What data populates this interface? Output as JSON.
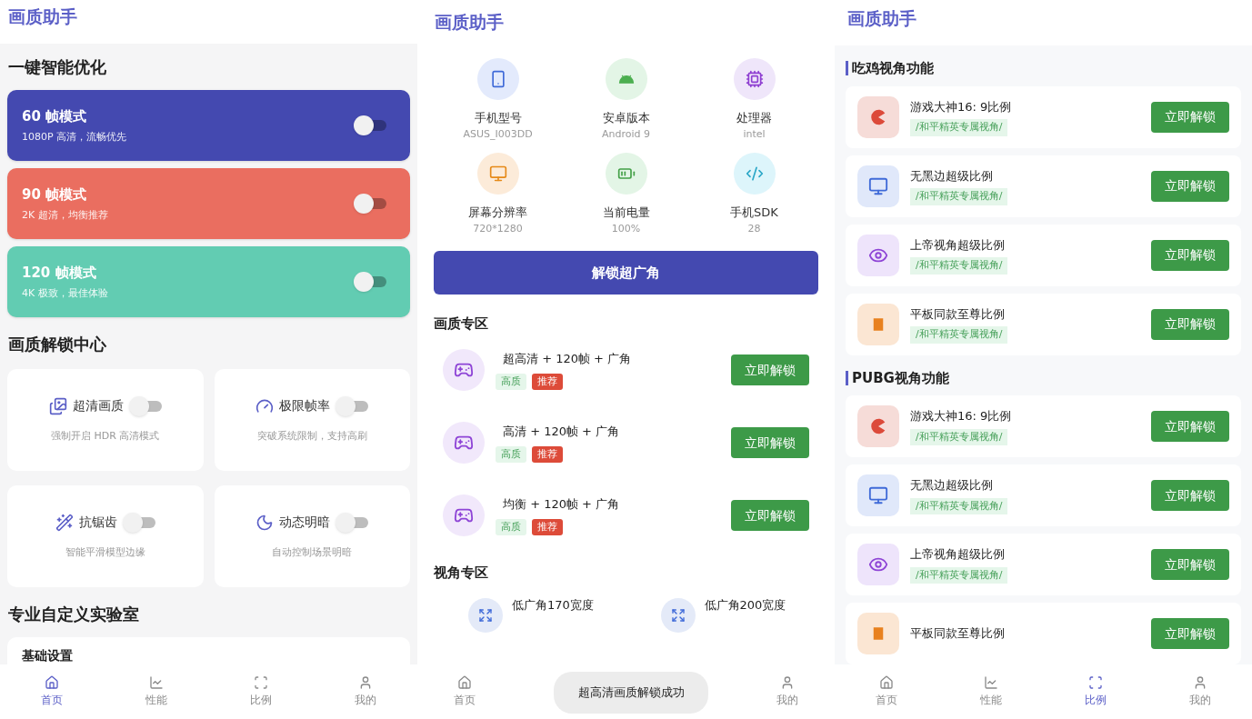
{
  "home_screen": {
    "title": "画质助手",
    "smart_heading": "一键智能优化",
    "modes": [
      {
        "name": "60 帧模式",
        "desc": "1080P 高清，流畅优先",
        "color": "#4449b0",
        "on": false
      },
      {
        "name": "90 帧模式",
        "desc": "2K 超清，均衡推荐",
        "color": "#ea6e60",
        "on": false
      },
      {
        "name": "120 帧模式",
        "desc": "4K 极致，最佳体验",
        "color": "#62ccb2",
        "on": false
      }
    ],
    "unlock_heading": "画质解锁中心",
    "features": [
      {
        "label": "超清画质",
        "desc": "强制开启 HDR 高清模式",
        "on": false
      },
      {
        "label": "极限帧率",
        "desc": "突破系统限制，支持高刷",
        "on": false
      },
      {
        "label": "抗锯齿",
        "desc": "智能平滑模型边缘",
        "on": false
      },
      {
        "label": "动态明暗",
        "desc": "自动控制场景明暗",
        "on": false
      }
    ],
    "lab_heading": "专业自定义实验室",
    "lab_card_title": "基础设置",
    "tab_bar": [
      {
        "label": "首页",
        "selected": true
      },
      {
        "label": "性能",
        "selected": false
      },
      {
        "label": "比例",
        "selected": false
      },
      {
        "label": "我的",
        "selected": false
      }
    ]
  },
  "device_screen": {
    "title": "画质助手",
    "specs": [
      {
        "label": "手机型号",
        "value": "ASUS_I003DD"
      },
      {
        "label": "安卓版本",
        "value": "Android 9"
      },
      {
        "label": "处理器",
        "value": "intel"
      },
      {
        "label": "屏幕分辨率",
        "value": "720*1280"
      },
      {
        "label": "当前电量",
        "value": "100%"
      },
      {
        "label": "手机SDK",
        "value": "28"
      }
    ],
    "wide_button": "解锁超广角",
    "quality_heading": "画质专区",
    "quality_items": [
      {
        "name": "超高清 + 120帧 + 广角",
        "tags": [
          {
            "label": "高质",
            "kind": "quality"
          },
          {
            "label": "推荐",
            "kind": "recommend"
          }
        ],
        "button": "立即解锁"
      },
      {
        "name": "高清 + 120帧 + 广角",
        "tags": [
          {
            "label": "高质",
            "kind": "quality"
          },
          {
            "label": "推荐",
            "kind": "recommend"
          }
        ],
        "button": "立即解锁"
      },
      {
        "name": "均衡 + 120帧 + 广角",
        "tags": [
          {
            "label": "高质",
            "kind": "quality"
          },
          {
            "label": "推荐",
            "kind": "recommend"
          }
        ],
        "button": "立即解锁"
      }
    ],
    "view_heading": "视角专区",
    "view_items": [
      {
        "name": "低广角170宽度"
      },
      {
        "name": "低广角200宽度"
      }
    ],
    "left_tab": {
      "label": "首页",
      "selected": false
    },
    "right_tab": {
      "label": "我的",
      "selected": false
    },
    "toast": "超高清画质解锁成功"
  },
  "ratio_screen": {
    "title": "画质助手",
    "groups": [
      {
        "heading": "吃鸡视角功能",
        "items": [
          {
            "name": "游戏大神16: 9比例",
            "tag": "/和平精英专属视角/",
            "button": "立即解锁"
          },
          {
            "name": "无黑边超级比例",
            "tag": "/和平精英专属视角/",
            "button": "立即解锁"
          },
          {
            "name": "上帝视角超级比例",
            "tag": "/和平精英专属视角/",
            "button": "立即解锁"
          },
          {
            "name": "平板同款至尊比例",
            "tag": "/和平精英专属视角/",
            "button": "立即解锁"
          }
        ]
      },
      {
        "heading": "PUBG视角功能",
        "items": [
          {
            "name": "游戏大神16: 9比例",
            "tag": "/和平精英专属视角/",
            "button": "立即解锁"
          },
          {
            "name": "无黑边超级比例",
            "tag": "/和平精英专属视角/",
            "button": "立即解锁"
          },
          {
            "name": "上帝视角超级比例",
            "tag": "/和平精英专属视角/",
            "button": "立即解锁"
          },
          {
            "name": "平板同款至尊比例",
            "button": "立即解锁"
          }
        ]
      }
    ],
    "tab_bar": [
      {
        "label": "首页",
        "selected": false
      },
      {
        "label": "性能",
        "selected": false
      },
      {
        "label": "比例",
        "selected": true
      },
      {
        "label": "我的",
        "selected": false
      }
    ]
  }
}
